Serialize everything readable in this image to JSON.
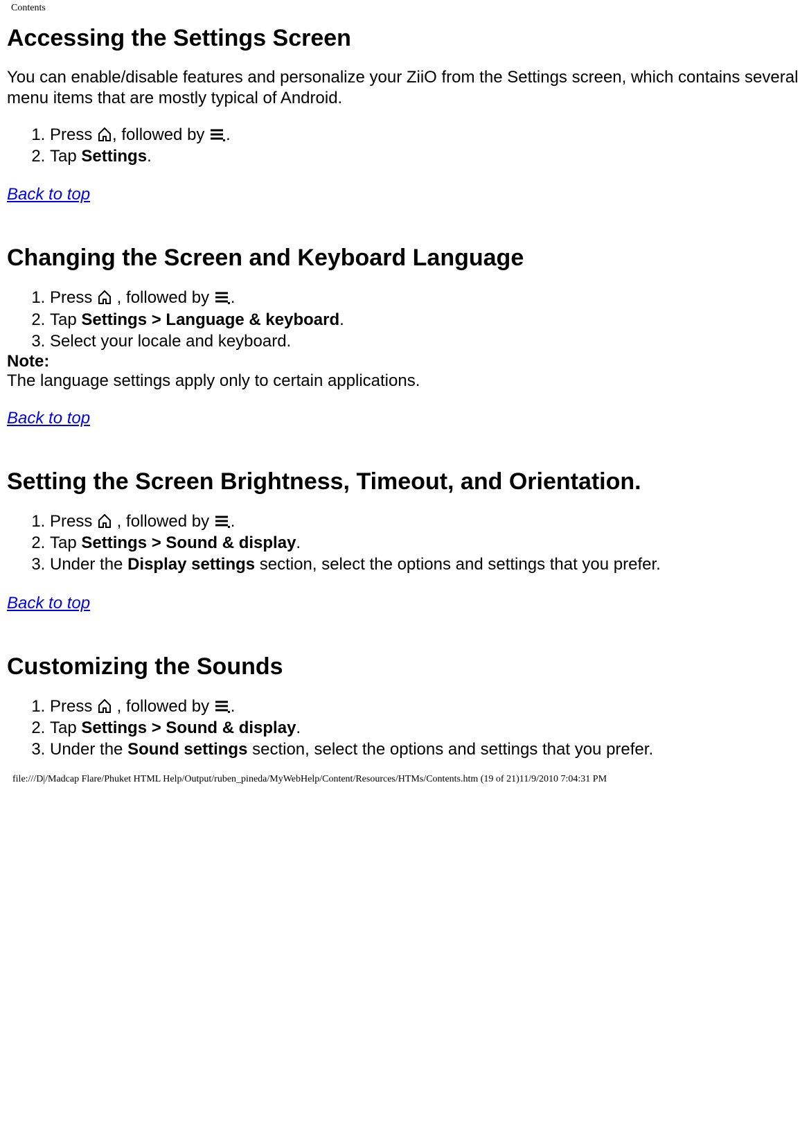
{
  "header": "Contents",
  "footer": "file:///D|/Madcap Flare/Phuket HTML Help/Output/ruben_pineda/MyWebHelp/Content/Resources/HTMs/Contents.htm (19 of 21)11/9/2010 7:04:31 PM",
  "back_to_top": "Back to top",
  "icons": {
    "home": "home-icon",
    "menu": "menu-icon"
  },
  "sections": {
    "s1": {
      "title": "Accessing the Settings Screen",
      "intro": "You can enable/disable features and personalize your ZiiO from the Settings screen, which contains several menu items that are mostly typical of Android.",
      "step1_a": "Press ",
      "step1_b": ", followed by ",
      "step1_c": ".",
      "step2_a": "Tap ",
      "step2_b": "Settings",
      "step2_c": "."
    },
    "s2": {
      "title": "Changing the Screen and Keyboard Language",
      "step1_a": "Press ",
      "step1_b": " , followed by ",
      "step1_c": ".",
      "step2_a": "Tap ",
      "step2_b": "Settings > Language & keyboard",
      "step2_c": ".",
      "step3": "Select your locale and keyboard.",
      "note_label": "Note:",
      "note_text": "The language settings apply only to certain applications."
    },
    "s3": {
      "title": "Setting the Screen Brightness, Timeout, and Orientation.",
      "step1_a": "Press ",
      "step1_b": " , followed by ",
      "step1_c": ".",
      "step2_a": "Tap ",
      "step2_b": "Settings > Sound & display",
      "step2_c": ".",
      "step3_a": "Under the ",
      "step3_b": "Display settings",
      "step3_c": " section, select the options and settings that you prefer."
    },
    "s4": {
      "title": "Customizing the Sounds",
      "step1_a": "Press ",
      "step1_b": " , followed by ",
      "step1_c": ".",
      "step2_a": "Tap ",
      "step2_b": "Settings > Sound & display",
      "step2_c": ".",
      "step3_a": "Under the ",
      "step3_b": "Sound settings",
      "step3_c": " section, select the options and settings that you prefer."
    }
  }
}
